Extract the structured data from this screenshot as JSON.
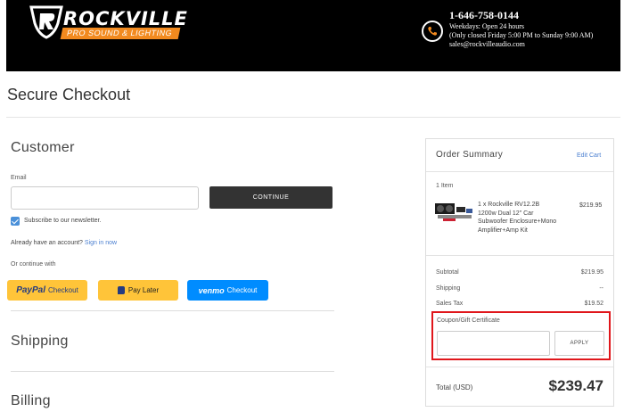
{
  "header": {
    "logo_word": "ROCKVILLE",
    "logo_tagline": "PRO SOUND & LIGHTING",
    "phone": "1-646-758-0144",
    "hours": "Weekdays: Open 24 hours",
    "closed_note": "(Only closed Friday 5:00 PM to Sunday 9:00 AM)",
    "email": "sales@rockvilleaudio.com",
    "phone_icon": "phone-icon",
    "accent_color": "#f28a1f"
  },
  "page": {
    "title": "Secure Checkout"
  },
  "customer": {
    "heading": "Customer",
    "email_label": "Email",
    "email_value": "",
    "continue_label": "CONTINUE",
    "newsletter_label": "Subscribe to our newsletter.",
    "newsletter_checked": true,
    "account_prompt": "Already have an account?",
    "signin_link": "Sign in now",
    "continue_with": "Or continue with",
    "paypal_brand": "PayPal",
    "paypal_text": "Checkout",
    "paylater_text": "Pay Later",
    "venmo_brand": "venmo",
    "venmo_text": "Checkout"
  },
  "shipping": {
    "heading": "Shipping"
  },
  "billing": {
    "heading": "Billing"
  },
  "summary": {
    "title": "Order Summary",
    "edit_cart": "Edit Cart",
    "items_count": "1 Item",
    "product_name": "1 x Rockville RV12.2B 1200w Dual 12\" Car Subwoofer Enclosure+Mono Amplifier+Amp Kit",
    "product_price": "$219.95",
    "subtotal_label": "Subtotal",
    "subtotal_value": "$219.95",
    "shipping_label": "Shipping",
    "shipping_value": "--",
    "tax_label": "Sales Tax",
    "tax_value": "$19.52",
    "coupon_label": "Coupon/Gift Certificate",
    "coupon_value": "",
    "apply_label": "APPLY",
    "total_label": "Total (USD)",
    "total_value": "$239.47",
    "highlight_color": "#e0161b"
  }
}
